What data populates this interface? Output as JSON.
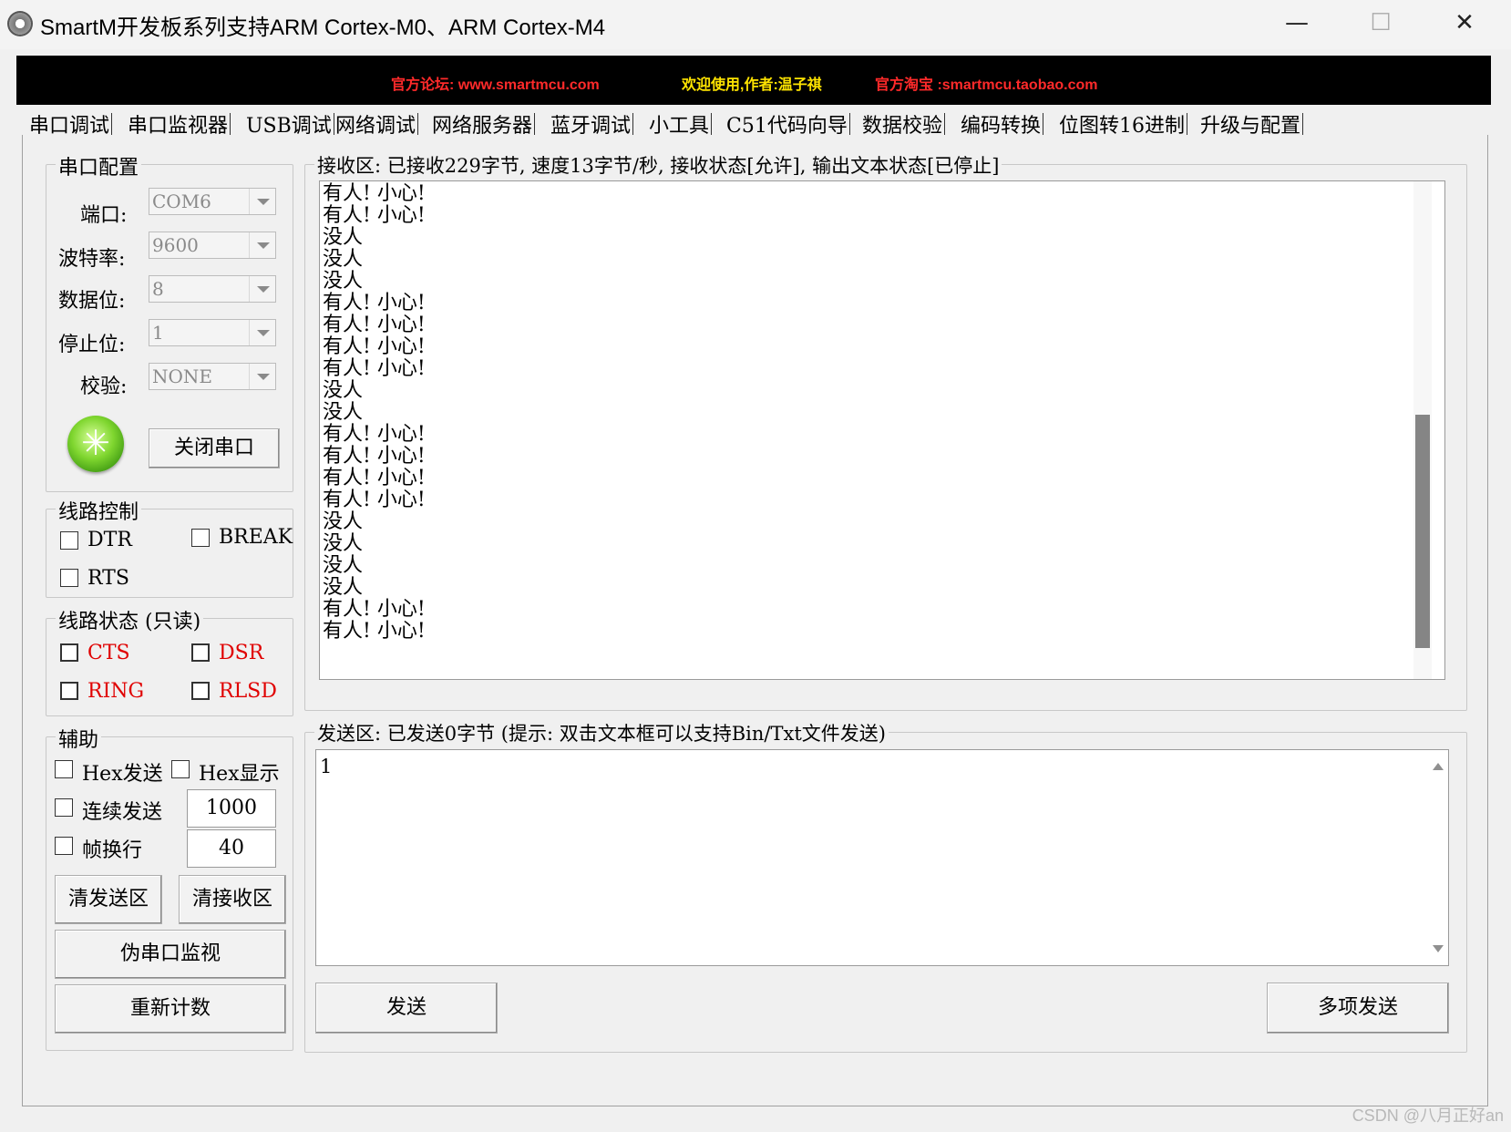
{
  "window": {
    "title": "SmartM开发板系列支持ARM Cortex-M0、ARM Cortex-M4",
    "minimize": "—",
    "maximize": "☐",
    "close": "✕"
  },
  "banner": {
    "forum": "官方论坛: www.smartmcu.com",
    "welcome": "欢迎使用,作者:温子祺",
    "taobao": "官方淘宝 :smartmcu.taobao.com"
  },
  "tabs": [
    "串口调试",
    "串口监视器",
    "USB调试",
    "网络调试",
    "网络服务器",
    "蓝牙调试",
    "小工具",
    "C51代码向导",
    "数据校验",
    "编码转换",
    "位图转16进制",
    "升级与配置"
  ],
  "serial_config": {
    "title": "串口配置",
    "port_label": "端口:",
    "port_value": "COM6",
    "baud_label": "波特率:",
    "baud_value": "9600",
    "databits_label": "数据位:",
    "databits_value": "8",
    "stopbits_label": "停止位:",
    "stopbits_value": "1",
    "parity_label": "校验:",
    "parity_value": "NONE",
    "close_port_button": "关闭串口"
  },
  "line_control": {
    "title": "线路控制",
    "dtr": "DTR",
    "break": "BREAK",
    "rts": "RTS"
  },
  "line_status": {
    "title": "线路状态 (只读)",
    "cts": "CTS",
    "dsr": "DSR",
    "ring": "RING",
    "rlsd": "RLSD"
  },
  "aux": {
    "title": "辅助",
    "hex_send": "Hex发送",
    "hex_display": "Hex显示",
    "continuous_send": "连续发送",
    "continuous_interval": "1000",
    "frame_newline": "帧换行",
    "frame_value": "40",
    "clear_send_button": "清发送区",
    "clear_receive_button": "清接收区",
    "pseudo_monitor_button": "伪串口监视",
    "recount_button": "重新计数"
  },
  "receive": {
    "title": "接收区: 已接收229字节, 速度13字节/秒, 接收状态[允许], 输出文本状态[已停止]",
    "lines": [
      "有人! 小心!",
      "有人! 小心!",
      "没人",
      "没人",
      "没人",
      "有人! 小心!",
      "有人! 小心!",
      "有人! 小心!",
      "有人! 小心!",
      "没人",
      "没人",
      "有人! 小心!",
      "有人! 小心!",
      "有人! 小心!",
      "有人! 小心!",
      "没人",
      "没人",
      "没人",
      "没人",
      "有人! 小心!",
      "有人! 小心!"
    ]
  },
  "send": {
    "title": "发送区: 已发送0字节 (提示: 双击文本框可以支持Bin/Txt文件发送)",
    "content": "1",
    "send_button": "发送",
    "multi_send_button": "多项发送"
  },
  "watermark": "CSDN @八月正好an"
}
